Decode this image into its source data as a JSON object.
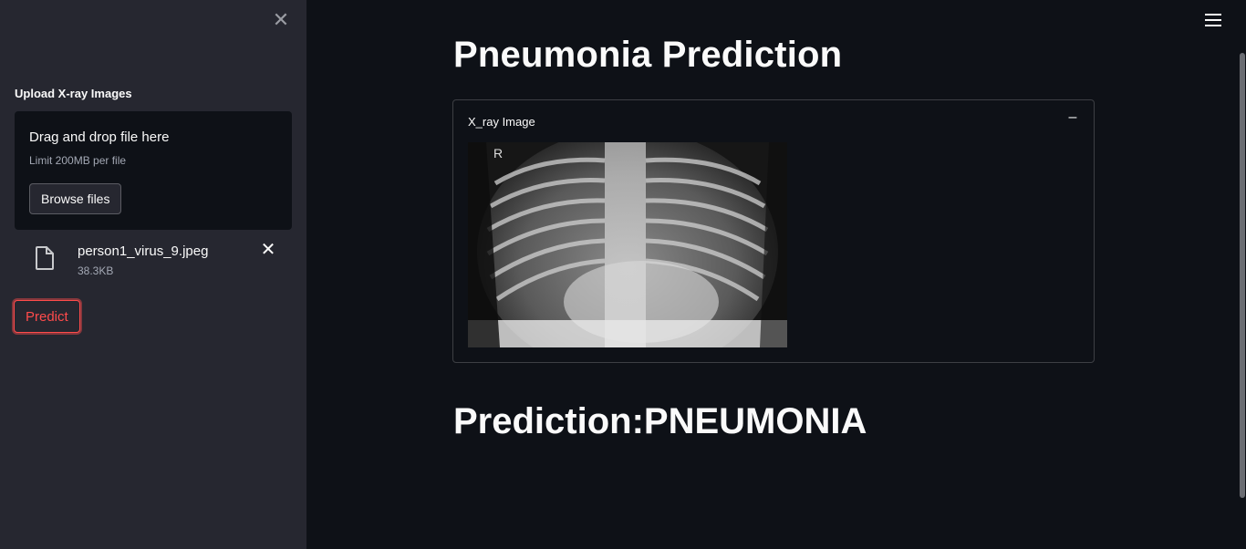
{
  "sidebar": {
    "upload_label": "Upload X-ray Images",
    "dropzone": {
      "title": "Drag and drop file here",
      "limit": "Limit 200MB per file",
      "browse_label": "Browse files"
    },
    "file": {
      "name": "person1_virus_9.jpeg",
      "size": "38.3KB"
    },
    "predict_label": "Predict"
  },
  "main": {
    "title": "Pneumonia Prediction",
    "expander": {
      "header": "X_ray Image",
      "image_marker": "R"
    },
    "prediction": "Prediction:PNEUMONIA"
  },
  "colors": {
    "background": "#0e1117",
    "sidebar": "#262730",
    "accent": "#ff4b4b"
  },
  "icons": {
    "sidebar_close": "close-icon",
    "file": "file-icon",
    "file_remove": "close-icon",
    "menu": "hamburger-menu-icon",
    "expander_toggle": "collapse-icon"
  }
}
